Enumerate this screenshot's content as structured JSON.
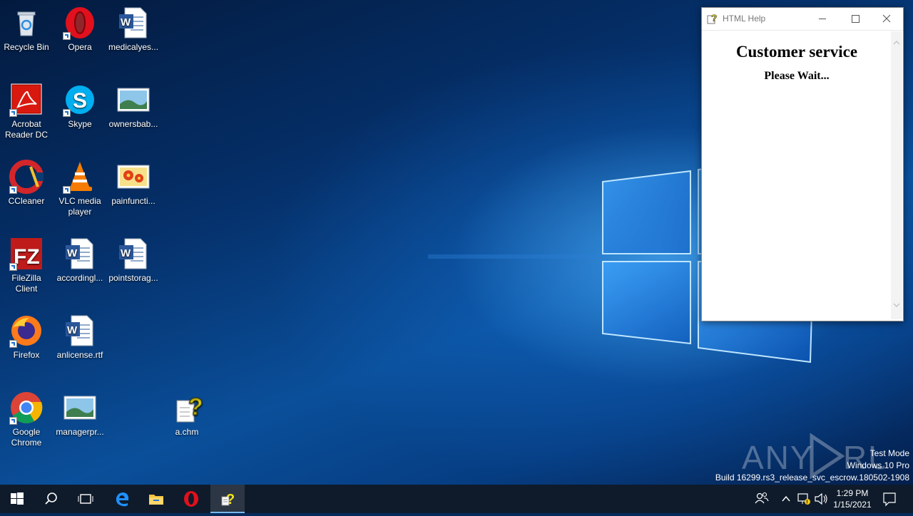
{
  "desktop_icons": [
    {
      "label": "Recycle Bin",
      "icon": "recycle-bin-icon"
    },
    {
      "label": "Opera",
      "icon": "opera-icon"
    },
    {
      "label": "medicalyes...",
      "icon": "word-document-icon"
    },
    {
      "label": "Acrobat Reader DC",
      "icon": "acrobat-reader-icon"
    },
    {
      "label": "Skype",
      "icon": "skype-icon"
    },
    {
      "label": "ownersbab...",
      "icon": "image-file-icon"
    },
    {
      "label": "CCleaner",
      "icon": "ccleaner-icon"
    },
    {
      "label": "VLC media player",
      "icon": "vlc-icon"
    },
    {
      "label": "painfuncti...",
      "icon": "image-file-icon"
    },
    {
      "label": "FileZilla Client",
      "icon": "filezilla-icon"
    },
    {
      "label": "accordingl...",
      "icon": "word-document-icon"
    },
    {
      "label": "pointstorag...",
      "icon": "word-document-icon"
    },
    {
      "label": "Firefox",
      "icon": "firefox-icon"
    },
    {
      "label": "anlicense.rtf",
      "icon": "word-document-icon"
    },
    {
      "label": "Google Chrome",
      "icon": "chrome-icon"
    },
    {
      "label": "managerpr...",
      "icon": "image-file-icon"
    },
    {
      "label": "a.chm",
      "icon": "chm-help-file-icon"
    }
  ],
  "help_window": {
    "title": "HTML Help",
    "heading": "Customer service",
    "subheading": "Please Wait...",
    "buttons": {
      "minimize": "minimize-icon",
      "maximize": "maximize-icon",
      "close": "close-icon"
    }
  },
  "watermark": {
    "brand": "ANY RUN",
    "line1": "Test Mode",
    "line2": "Windows 10 Pro",
    "line3": "Build 16299.rs3_release_svc_escrow.180502-1908"
  },
  "taskbar": {
    "items": [
      "start-icon",
      "search-icon",
      "task-view-icon",
      "edge-icon",
      "file-explorer-icon",
      "opera-icon",
      "html-help-icon"
    ],
    "tray": [
      "people-icon",
      "chevron-up-icon",
      "network-icon",
      "volume-icon",
      "action-center-icon"
    ],
    "time": "1:29 PM",
    "date": "1/15/2021"
  },
  "colors": {
    "taskbar": "#0f1b2b",
    "accent": "#76b9ed"
  }
}
